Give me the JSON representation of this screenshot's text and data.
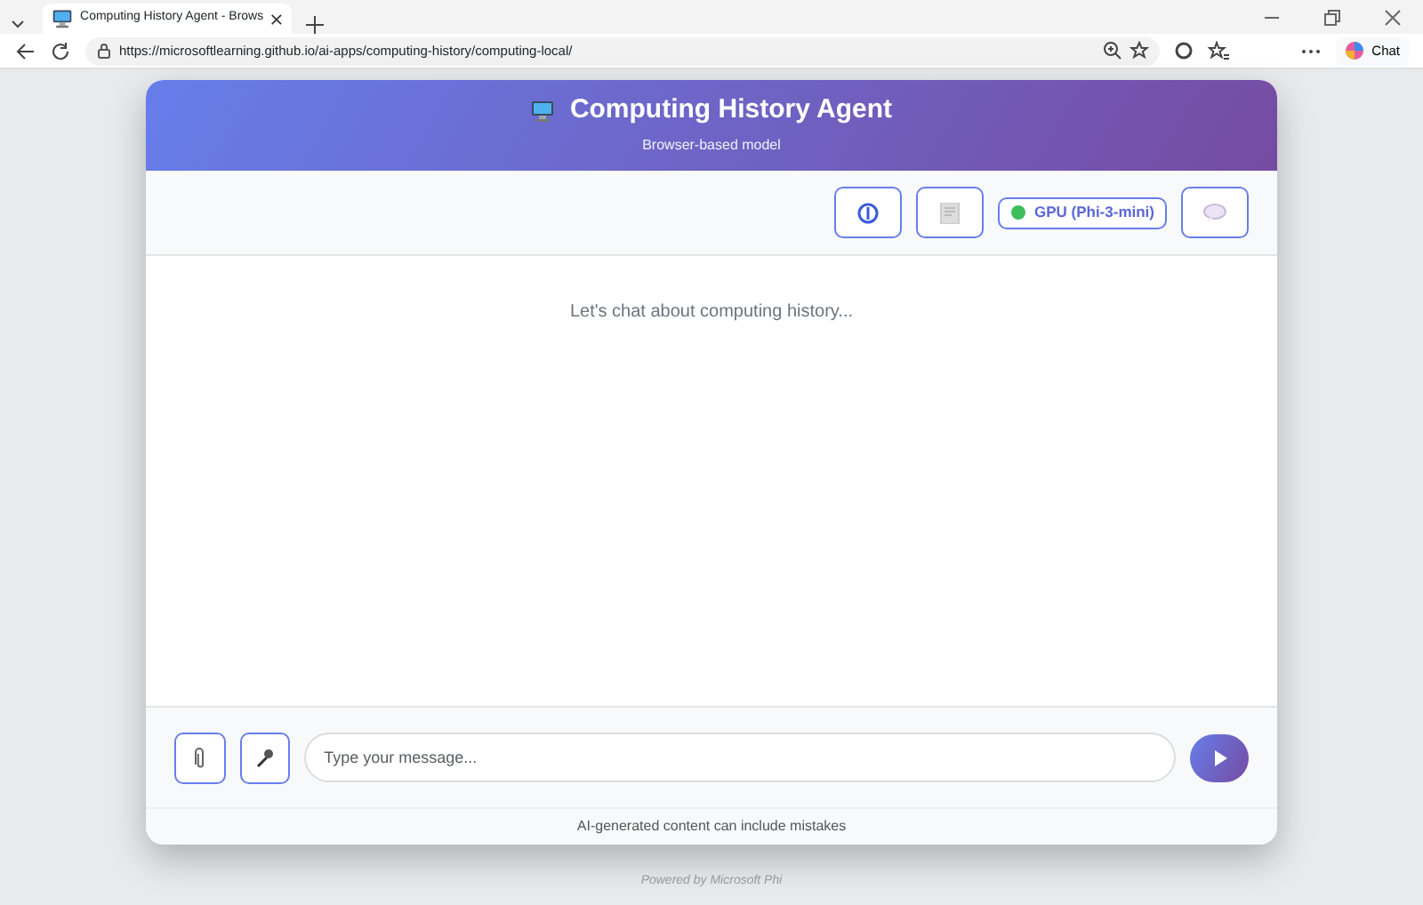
{
  "browser": {
    "tab_title": "Computing History Agent - Brows",
    "url": "https://microsoftlearning.github.io/ai-apps/computing-history/computing-local/",
    "chat_button": "Chat"
  },
  "app": {
    "title": "Computing History Agent",
    "subtitle": "Browser-based model",
    "toolbar": [
      {
        "kind": "info"
      },
      {
        "kind": "document"
      },
      {
        "kind": "model",
        "label": "GPU (Phi-3-mini)"
      },
      {
        "kind": "chat"
      }
    ],
    "empty_message": "Let's chat about computing history...",
    "input_buttons": [
      {
        "kind": "attach"
      },
      {
        "kind": "microphone"
      }
    ],
    "placeholder": "Type your message...",
    "disclaimer": "AI-generated content can include mistakes"
  },
  "footer": "Powered by Microsoft Phi"
}
